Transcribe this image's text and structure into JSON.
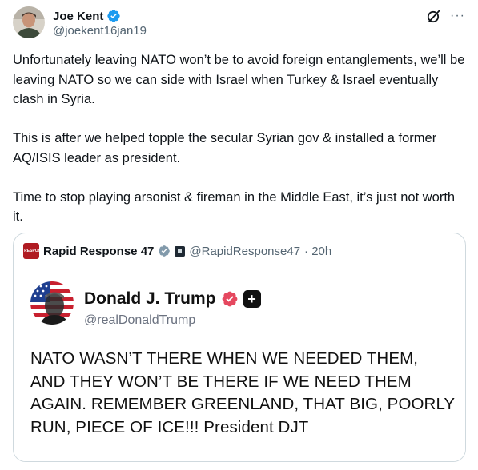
{
  "tweet": {
    "author": {
      "name": "Joe Kent",
      "handle": "@joekent16jan19"
    },
    "icons": [
      "verified-badge-icon",
      "grok-icon",
      "more-icon"
    ],
    "more_label": "···",
    "paragraphs": [
      "Unfortunately leaving NATO won’t be to avoid foreign entanglements, we’ll be leaving NATO so we can side with Israel when Turkey & Israel eventually clash in Syria.",
      "This is after we helped topple the secular Syrian gov & installed a former AQ/ISIS leader as president.",
      "Time to stop playing arsonist & fireman in the Middle East, it’s just not worth it."
    ]
  },
  "quote": {
    "author": {
      "name": "Rapid Response 47",
      "handle": "@RapidResponse47",
      "time": "· 20h",
      "avatar_text": "RAPID RESPONSE 47"
    },
    "embed": {
      "name": "Donald J. Trump",
      "handle": "@realDonaldTrump",
      "plus_label": "+",
      "text": "NATO WASN’T THERE WHEN WE NEEDED THEM, AND THEY WON’T BE THERE IF WE NEED THEM AGAIN. REMEMBER GREENLAND, THAT BIG, POORLY RUN, PIECE OF ICE!!! President DJT"
    }
  },
  "colors": {
    "verified_blue": "#1d9bf0",
    "truth_verified": "#e5485f",
    "secondary_text": "#536471",
    "border": "#cfd9de"
  }
}
